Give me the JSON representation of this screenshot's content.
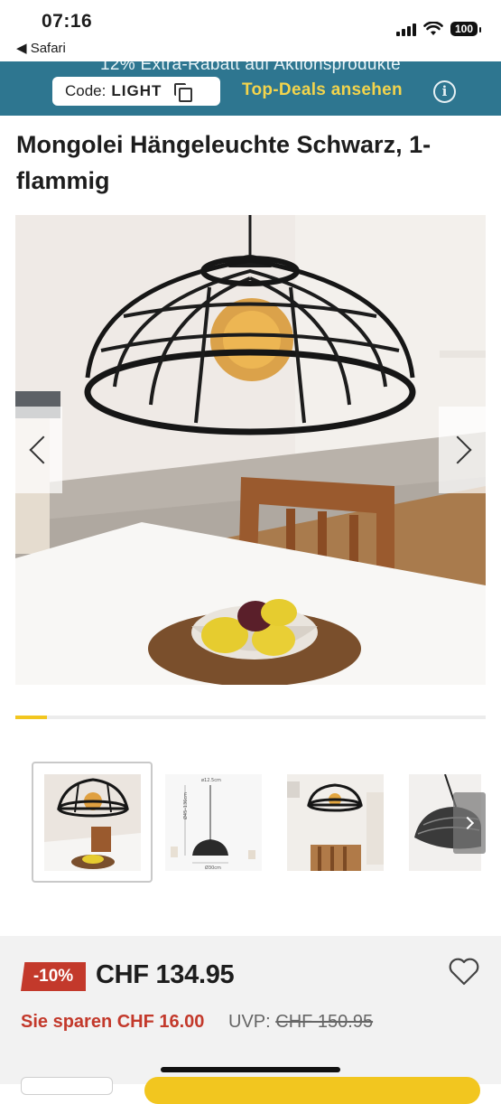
{
  "status_bar": {
    "time": "07:16",
    "back_label": "◀ Safari",
    "battery": "100"
  },
  "promo": {
    "headline": "12% Extra-Rabatt auf Aktionsprodukte",
    "code_label": "Code:",
    "code_value": "LIGHT",
    "link": "Top-Deals ansehen",
    "info_icon": "info-icon",
    "copy_icon": "copy-icon"
  },
  "product": {
    "title": "Mongolei Hängeleuchte Schwarz, 1-flammig"
  },
  "gallery": {
    "current_index": 1,
    "total_images": 4,
    "progress": 0.067,
    "prev_icon": "chevron-left-icon",
    "next_icon": "chevron-right-icon",
    "thumb_dim_top": "ø12.5cm",
    "thumb_dim_height": "Ø45–136cm",
    "thumb_dim_bottom": "Ø30cm"
  },
  "pricing": {
    "discount": "-10%",
    "price": "CHF 134.95",
    "savings": "Sie sparen CHF 16.00",
    "uvp_label": "UVP:",
    "uvp_value": "CHF 150.95",
    "wishlist_icon": "heart-icon"
  },
  "colors": {
    "promo_bg": "#2e7690",
    "accent_yellow": "#f2c61f",
    "sale_red": "#c3392b"
  }
}
